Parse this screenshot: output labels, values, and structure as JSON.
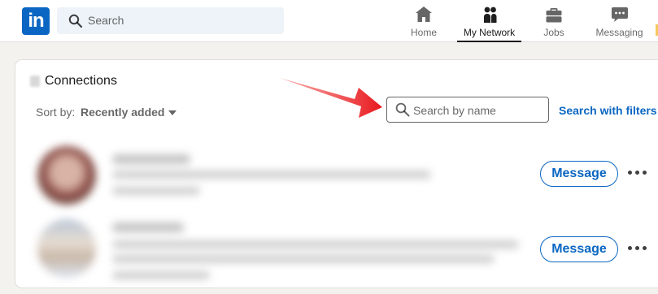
{
  "topbar": {
    "logo": "in",
    "search_placeholder": "Search",
    "nav": [
      {
        "label": "Home",
        "icon": "home-icon"
      },
      {
        "label": "My Network",
        "icon": "network-icon"
      },
      {
        "label": "Jobs",
        "icon": "briefcase-icon"
      },
      {
        "label": "Messaging",
        "icon": "messaging-icon"
      }
    ]
  },
  "connections": {
    "title": "Connections",
    "sort_label": "Sort by:",
    "sort_value": "Recently added",
    "search_placeholder": "Search by name",
    "filters_link": "Search with filters",
    "rows": [
      {
        "action": "Message"
      },
      {
        "action": "Message"
      }
    ]
  },
  "colors": {
    "brand": "#0a66c2",
    "annotation_arrow": "#e8161b"
  }
}
